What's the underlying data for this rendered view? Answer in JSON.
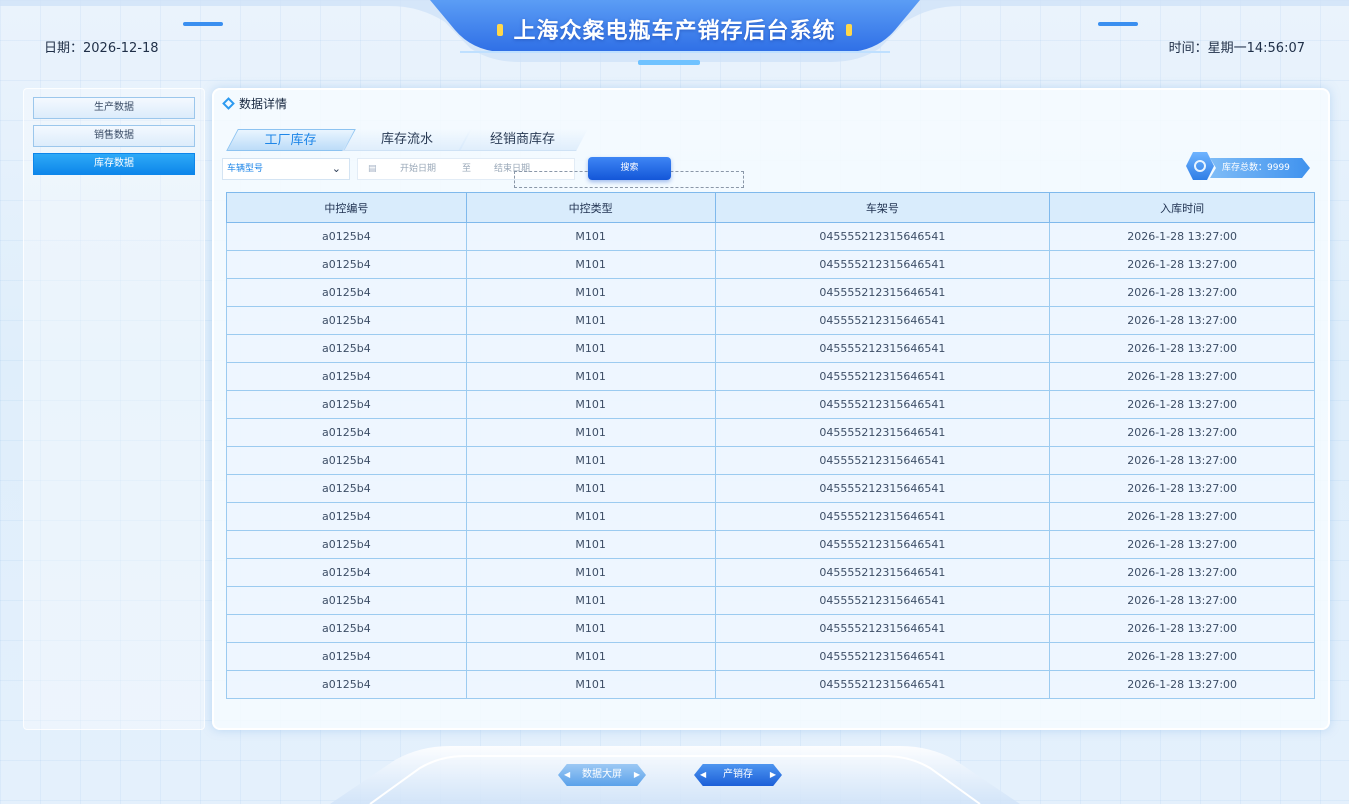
{
  "header": {
    "title": "上海众粲电瓶车产销存后台系统",
    "date": "日期：2026-12-18",
    "time": "时间：星期一14:56:07"
  },
  "sidebar": {
    "items": [
      {
        "label": "生产数据",
        "active": false
      },
      {
        "label": "销售数据",
        "active": false
      },
      {
        "label": "库存数据",
        "active": true
      }
    ]
  },
  "panel": {
    "title": "数据详情",
    "tabs": [
      {
        "label": "工厂库存",
        "active": true
      },
      {
        "label": "库存流水",
        "active": false
      },
      {
        "label": "经销商库存",
        "active": false
      }
    ],
    "filters": {
      "vehicle_model": "车辆型号",
      "start_date_placeholder": "开始日期",
      "to": "至",
      "end_date_placeholder": "结束日期",
      "search_button": "搜索"
    },
    "stock_total": "库存总数：9999"
  },
  "table": {
    "columns": [
      "中控编号",
      "中控类型",
      "车架号",
      "入库时间"
    ],
    "rows": [
      [
        "a0125b4",
        "M101",
        "045555212315646541",
        "2026-1-28  13:27:00"
      ],
      [
        "a0125b4",
        "M101",
        "045555212315646541",
        "2026-1-28  13:27:00"
      ],
      [
        "a0125b4",
        "M101",
        "045555212315646541",
        "2026-1-28  13:27:00"
      ],
      [
        "a0125b4",
        "M101",
        "045555212315646541",
        "2026-1-28  13:27:00"
      ],
      [
        "a0125b4",
        "M101",
        "045555212315646541",
        "2026-1-28  13:27:00"
      ],
      [
        "a0125b4",
        "M101",
        "045555212315646541",
        "2026-1-28  13:27:00"
      ],
      [
        "a0125b4",
        "M101",
        "045555212315646541",
        "2026-1-28  13:27:00"
      ],
      [
        "a0125b4",
        "M101",
        "045555212315646541",
        "2026-1-28  13:27:00"
      ],
      [
        "a0125b4",
        "M101",
        "045555212315646541",
        "2026-1-28  13:27:00"
      ],
      [
        "a0125b4",
        "M101",
        "045555212315646541",
        "2026-1-28  13:27:00"
      ],
      [
        "a0125b4",
        "M101",
        "045555212315646541",
        "2026-1-28  13:27:00"
      ],
      [
        "a0125b4",
        "M101",
        "045555212315646541",
        "2026-1-28  13:27:00"
      ],
      [
        "a0125b4",
        "M101",
        "045555212315646541",
        "2026-1-28  13:27:00"
      ],
      [
        "a0125b4",
        "M101",
        "045555212315646541",
        "2026-1-28  13:27:00"
      ],
      [
        "a0125b4",
        "M101",
        "045555212315646541",
        "2026-1-28  13:27:00"
      ],
      [
        "a0125b4",
        "M101",
        "045555212315646541",
        "2026-1-28  13:27:00"
      ],
      [
        "a0125b4",
        "M101",
        "045555212315646541",
        "2026-1-28  13:27:00"
      ]
    ]
  },
  "footer": {
    "nav": [
      {
        "label": "数据大屏",
        "active": false
      },
      {
        "label": "产销存",
        "active": true
      }
    ]
  },
  "colors": {
    "accent": "#1e86e8",
    "active_sidebar": "#0d86ea",
    "search_button": "#1356d8",
    "table_border": "#9ccbf0",
    "header_blue": "#3f86f2"
  },
  "icons": [
    "calendar-icon",
    "chevron-down-icon",
    "diamond-icon",
    "refresh-icon"
  ]
}
